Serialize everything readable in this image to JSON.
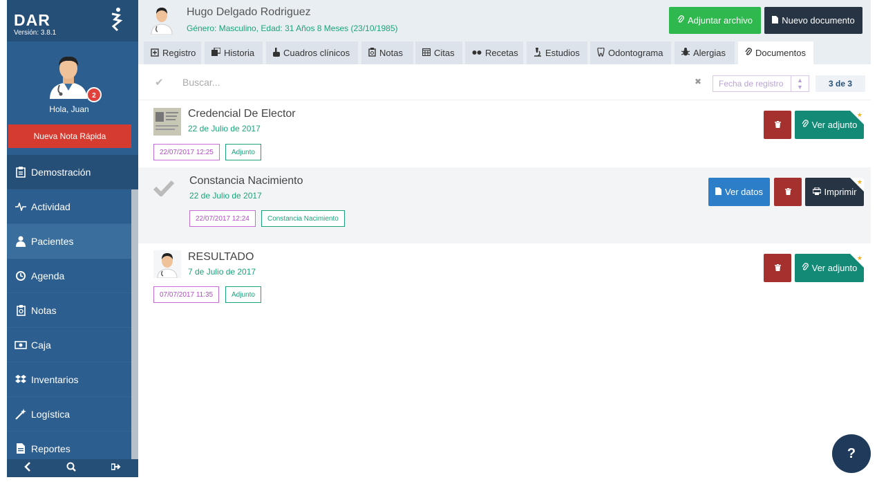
{
  "app": {
    "logo": "DAR",
    "version": "Versión: 3.8.1"
  },
  "sidebar": {
    "greeting": "Hola, Juan",
    "badge": "2",
    "quick_note": "Nueva Nota Rápida",
    "items": [
      {
        "label": "Demostración",
        "icon": "clipboard-icon"
      },
      {
        "label": "Actividad",
        "icon": "pulse-icon"
      },
      {
        "label": "Pacientes",
        "icon": "user-icon"
      },
      {
        "label": "Agenda",
        "icon": "clock-icon"
      },
      {
        "label": "Notas",
        "icon": "notes-icon"
      },
      {
        "label": "Caja",
        "icon": "money-icon"
      },
      {
        "label": "Inventarios",
        "icon": "dropbox-icon"
      },
      {
        "label": "Logística",
        "icon": "wand-icon"
      },
      {
        "label": "Reportes",
        "icon": "file-icon"
      }
    ]
  },
  "patient": {
    "name": "Hugo Delgado Rodriguez",
    "info": "Género: Masculino, Edad: 31 Años 8 Meses (23/10/1985)"
  },
  "header": {
    "attach_label": "Adjuntar archivo",
    "new_doc_label": "Nuevo documento"
  },
  "tabs": [
    {
      "label": "Registro"
    },
    {
      "label": "Historia"
    },
    {
      "label": "Cuadros clínicos"
    },
    {
      "label": "Notas"
    },
    {
      "label": "Citas"
    },
    {
      "label": "Recetas"
    },
    {
      "label": "Estudios"
    },
    {
      "label": "Odontograma"
    },
    {
      "label": "Alergias"
    },
    {
      "label": "Documentos"
    }
  ],
  "search": {
    "placeholder": "Buscar...",
    "date_placeholder": "Fecha de registro",
    "count": "3 de 3"
  },
  "documents": [
    {
      "title": "Credencial De Elector",
      "date": "22 de Julio de 2017",
      "timestamp": "22/07/2017 12:25",
      "type": "Adjunto",
      "action": "Ver adjunto"
    },
    {
      "title": "Constancia Nacimiento",
      "date": "22 de Julio de 2017",
      "timestamp": "22/07/2017 12:24",
      "type": "Constancia Nacimiento",
      "action_data": "Ver datos",
      "action": "Imprimir"
    },
    {
      "title": "RESULTADO",
      "date": "7 de Julio de 2017",
      "timestamp": "07/07/2017 11:35",
      "type": "Adjunto",
      "action": "Ver adjunto"
    }
  ],
  "colors": {
    "sidebar": "#2c5f8f",
    "green": "#2eb84d",
    "teal": "#138a76",
    "danger": "#a5312e",
    "accent_text": "#1aa37a"
  },
  "help": {
    "label": "?"
  }
}
